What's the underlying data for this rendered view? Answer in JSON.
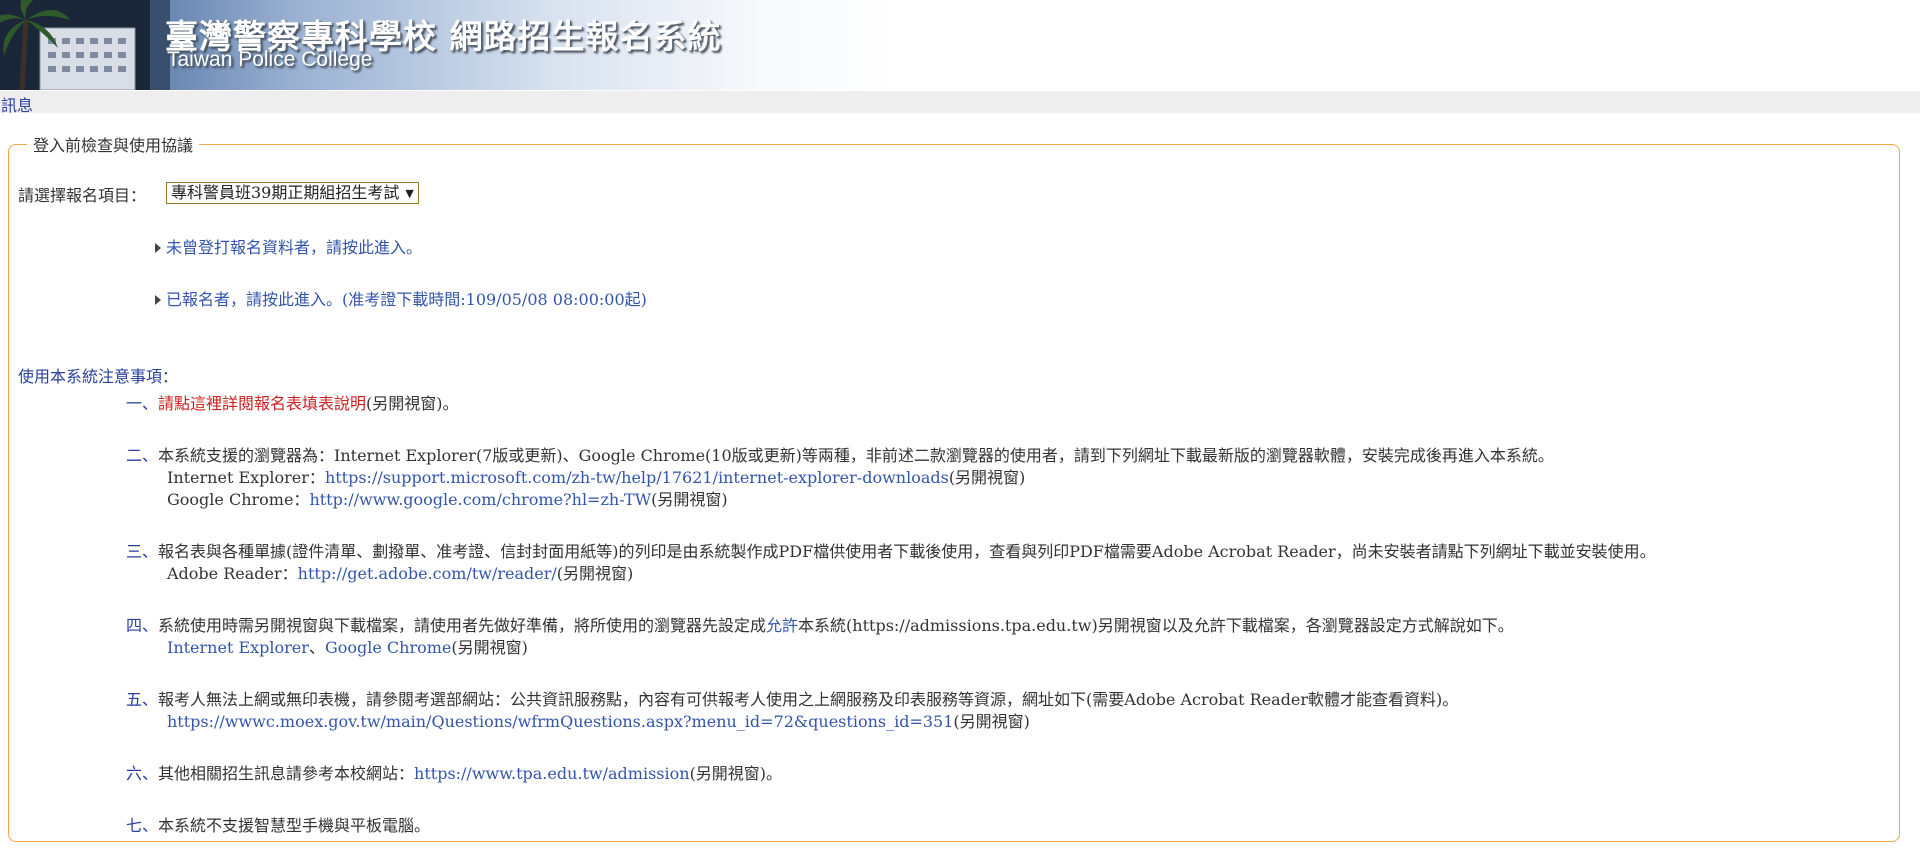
{
  "banner": {
    "title": "臺灣警察專科學校  網路招生報名系統",
    "subtitle": "Taiwan Police College"
  },
  "message_bar": {
    "label": "訊息"
  },
  "section": {
    "legend": "登入前檢查與使用協議",
    "select_label": "請選擇報名項目：",
    "select_value": "專科警員班39期正期組招生考試",
    "entry_new": "未曾登打報名資料者，請按此進入。",
    "entry_registered": "已報名者，請按此進入。(准考證下載時間:109/05/08 08:00:00起)"
  },
  "notice": {
    "title": "使用本系統注意事項：",
    "items": [
      {
        "num": "一、",
        "link": "請點這裡詳閱報名表填表說明",
        "suffix": "(另開視窗)。"
      },
      {
        "num": "二、",
        "text": "本系統支援的瀏覽器為：Internet Explorer(7版或更新)、Google Chrome(10版或更新)等兩種，非前述二款瀏覽器的使用者，請到下列網址下載最新版的瀏覽器軟體，安裝完成後再進入本系統。",
        "line2_prefix": "Internet Explorer：",
        "line2_link": "https://support.microsoft.com/zh-tw/help/17621/internet-explorer-downloads",
        "line2_suffix": "(另開視窗)",
        "line3_prefix": "Google Chrome：",
        "line3_link": "http://www.google.com/chrome?hl=zh-TW",
        "line3_suffix": "(另開視窗)"
      },
      {
        "num": "三、",
        "text": "報名表與各種單據(證件清單、劃撥單、准考證、信封封面用紙等)的列印是由系統製作成PDF檔供使用者下載後使用，查看與列印PDF檔需要Adobe Acrobat Reader，尚未安裝者請點下列網址下載並安裝使用。",
        "line2_prefix": "Adobe Reader：",
        "line2_link": "http://get.adobe.com/tw/reader/",
        "line2_suffix": "(另開視窗)"
      },
      {
        "num": "四、",
        "text_a": "系統使用時需另開視窗與下載檔案，請使用者先做好準備，將所使用的瀏覽器先設定成",
        "text_em": "允許",
        "text_b": "本系統(https://admissions.tpa.edu.tw)另開視窗以及允許下載檔案，各瀏覽器設定方式解說如下。",
        "link_ie": "Internet Explorer",
        "sep": "、",
        "link_chrome": "Google Chrome",
        "line2_suffix": "(另開視窗)"
      },
      {
        "num": "五、",
        "text": "報考人無法上網或無印表機，請參閱考選部網站：公共資訊服務點，內容有可供報考人使用之上網服務及印表服務等資源，網址如下(需要Adobe Acrobat Reader軟體才能查看資料)。",
        "line2_link": "https://wwwc.moex.gov.tw/main/Questions/wfrmQuestions.aspx?menu_id=72&questions_id=351",
        "line2_suffix": "(另開視窗)"
      },
      {
        "num": "六、",
        "text": "其他相關招生訊息請參考本校網站：",
        "link": "https://www.tpa.edu.tw/admission",
        "suffix": "(另開視窗)。"
      },
      {
        "num": "七、",
        "text": "本系統不支援智慧型手機與平板電腦。"
      }
    ]
  },
  "colors": {
    "accent_border": "#f0a64a",
    "link_blue": "#3355aa",
    "link_red": "#cc2222",
    "heading_blue": "#2a3f9f"
  }
}
